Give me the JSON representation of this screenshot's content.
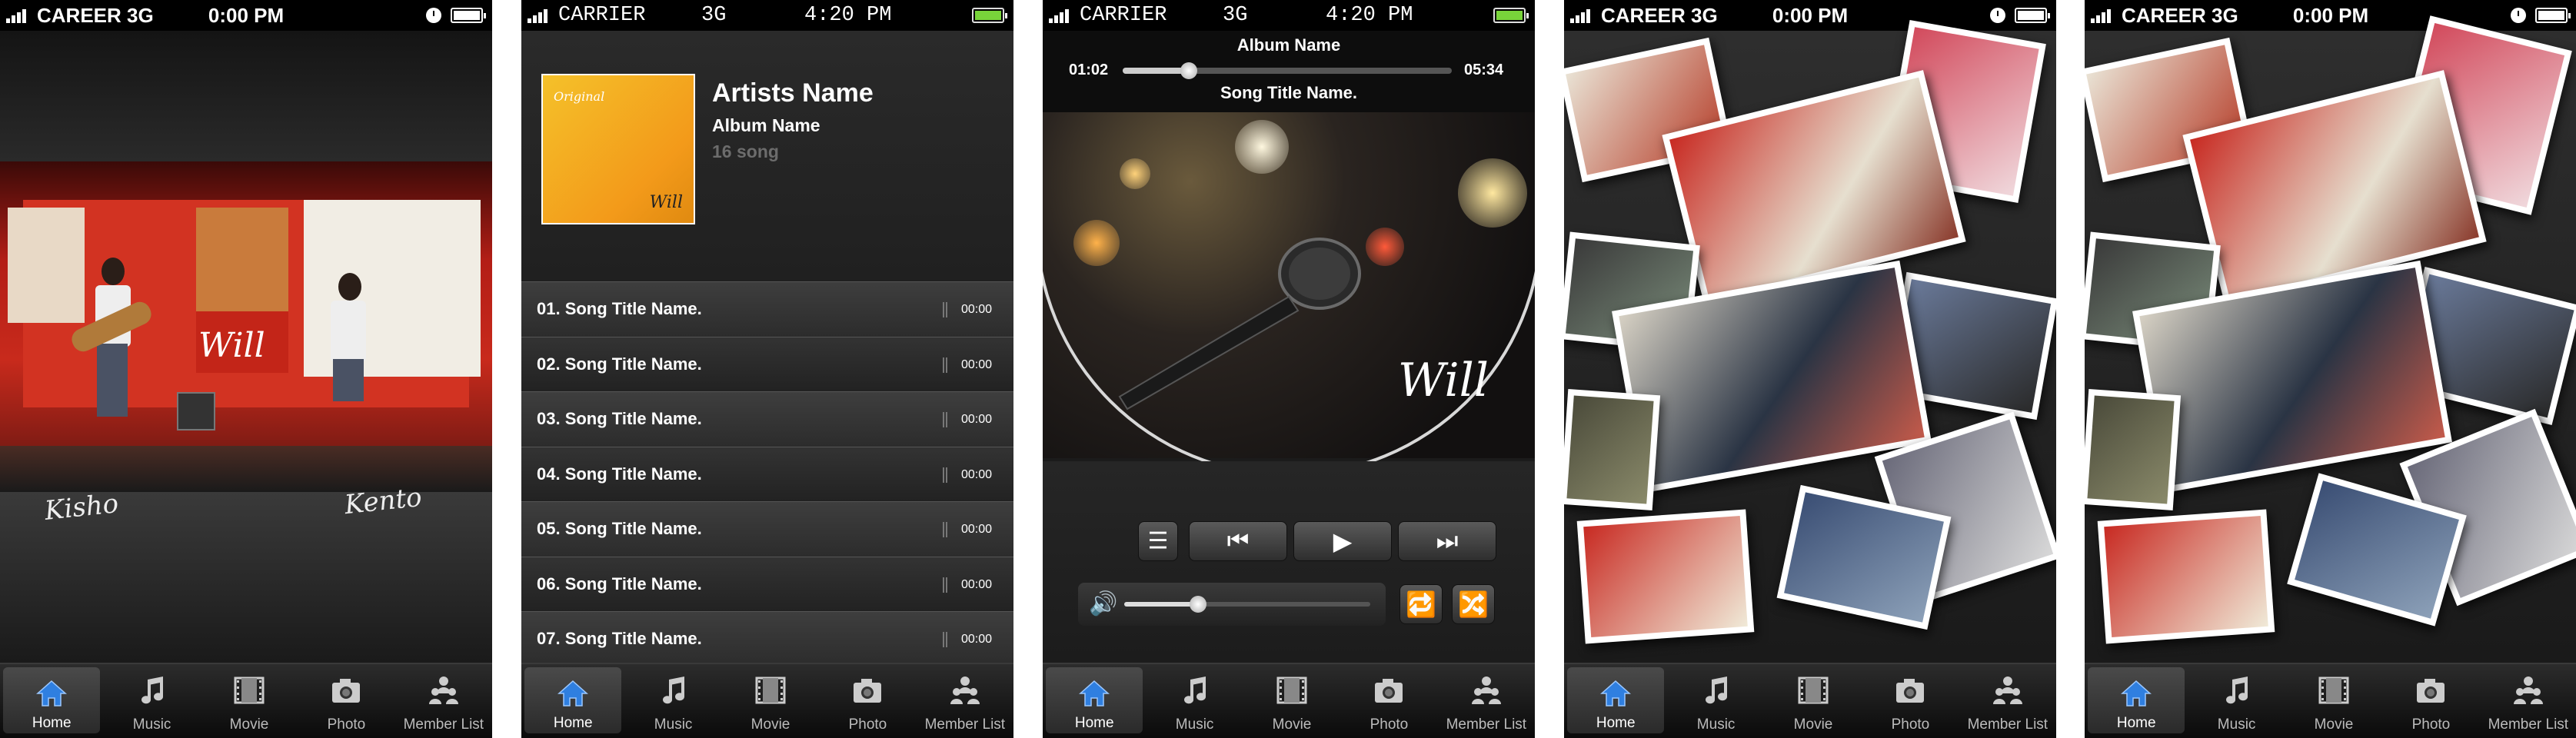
{
  "status_bars": [
    {
      "carrier": "CAREER 3G",
      "time": "0:00 PM"
    },
    {
      "carrier": "CARRIER",
      "network": "3G",
      "time": "4:20 PM"
    },
    {
      "carrier": "CARRIER",
      "network": "3G",
      "time": "4:20 PM"
    },
    {
      "carrier": "CAREER 3G",
      "time": "0:00 PM"
    },
    {
      "carrier": "CAREER 3G",
      "time": "0:00 PM"
    }
  ],
  "tabs": [
    {
      "label": "Home",
      "icon": "home-icon"
    },
    {
      "label": "Music",
      "icon": "music-note-icon"
    },
    {
      "label": "Movie",
      "icon": "film-icon"
    },
    {
      "label": "Photo",
      "icon": "camera-icon"
    },
    {
      "label": "Member List",
      "icon": "members-icon"
    }
  ],
  "home": {
    "logo": "Will",
    "signatures": [
      "Kisho",
      "Kento"
    ]
  },
  "music": {
    "cover_top_text": "Original",
    "cover_bottom_text": "Will",
    "artist": "Artists Name",
    "album": "Album Name",
    "song_count": "16 song",
    "songs": [
      {
        "title": "01. Song Title Name.",
        "duration": "00:00"
      },
      {
        "title": "02. Song Title Name.",
        "duration": "00:00"
      },
      {
        "title": "03. Song Title Name.",
        "duration": "00:00"
      },
      {
        "title": "04. Song Title Name.",
        "duration": "00:00"
      },
      {
        "title": "05. Song Title Name.",
        "duration": "00:00"
      },
      {
        "title": "06. Song Title Name.",
        "duration": "00:00"
      },
      {
        "title": "07. Song Title Name.",
        "duration": "00:00"
      }
    ]
  },
  "player": {
    "album": "Album Name",
    "elapsed": "01:02",
    "total": "05:34",
    "progress": 0.2,
    "song": "Song Title Name.",
    "watermark": "Will",
    "volume": 0.3,
    "buttons": {
      "list": "list-icon",
      "prev": "previous-icon",
      "play": "play-icon",
      "next": "next-icon",
      "repeat": "repeat-icon",
      "shuffle": "shuffle-icon",
      "volume": "speaker-icon"
    },
    "accent": "#37b6ff"
  },
  "colors": {
    "tab_active": "#2f7fe0",
    "battery_green": "#78d43a"
  }
}
